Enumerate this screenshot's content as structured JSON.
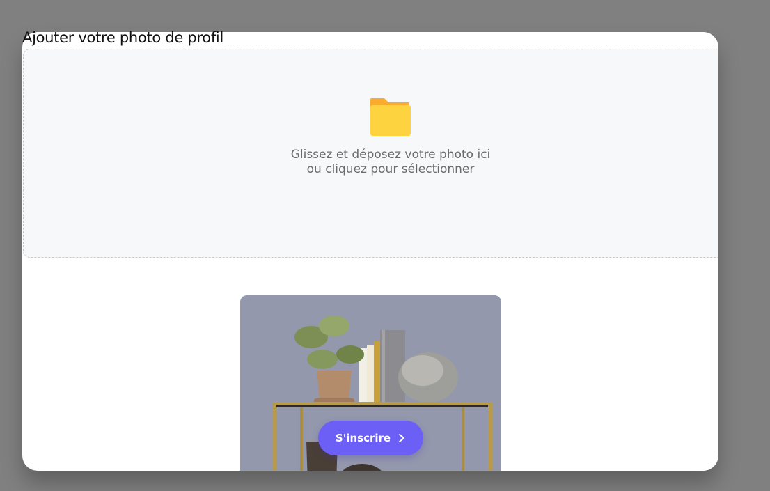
{
  "upload": {
    "title": "Ajouter votre photo de profil",
    "instruction_line1": "Glissez et déposez votre photo ici",
    "instruction_line2": "ou cliquez pour sélectionner",
    "icon": "folder-icon"
  },
  "preview": {
    "image": "shelf-with-plant-and-books"
  },
  "cta": {
    "label": "S'inscrire",
    "icon": "chevron-right-icon",
    "color": "#6c5ff5"
  },
  "colors": {
    "overlay": "#808080",
    "dropzone_bg": "#f7f8fa",
    "folder": "#fdd440",
    "folder_tab": "#f9ab2d"
  }
}
